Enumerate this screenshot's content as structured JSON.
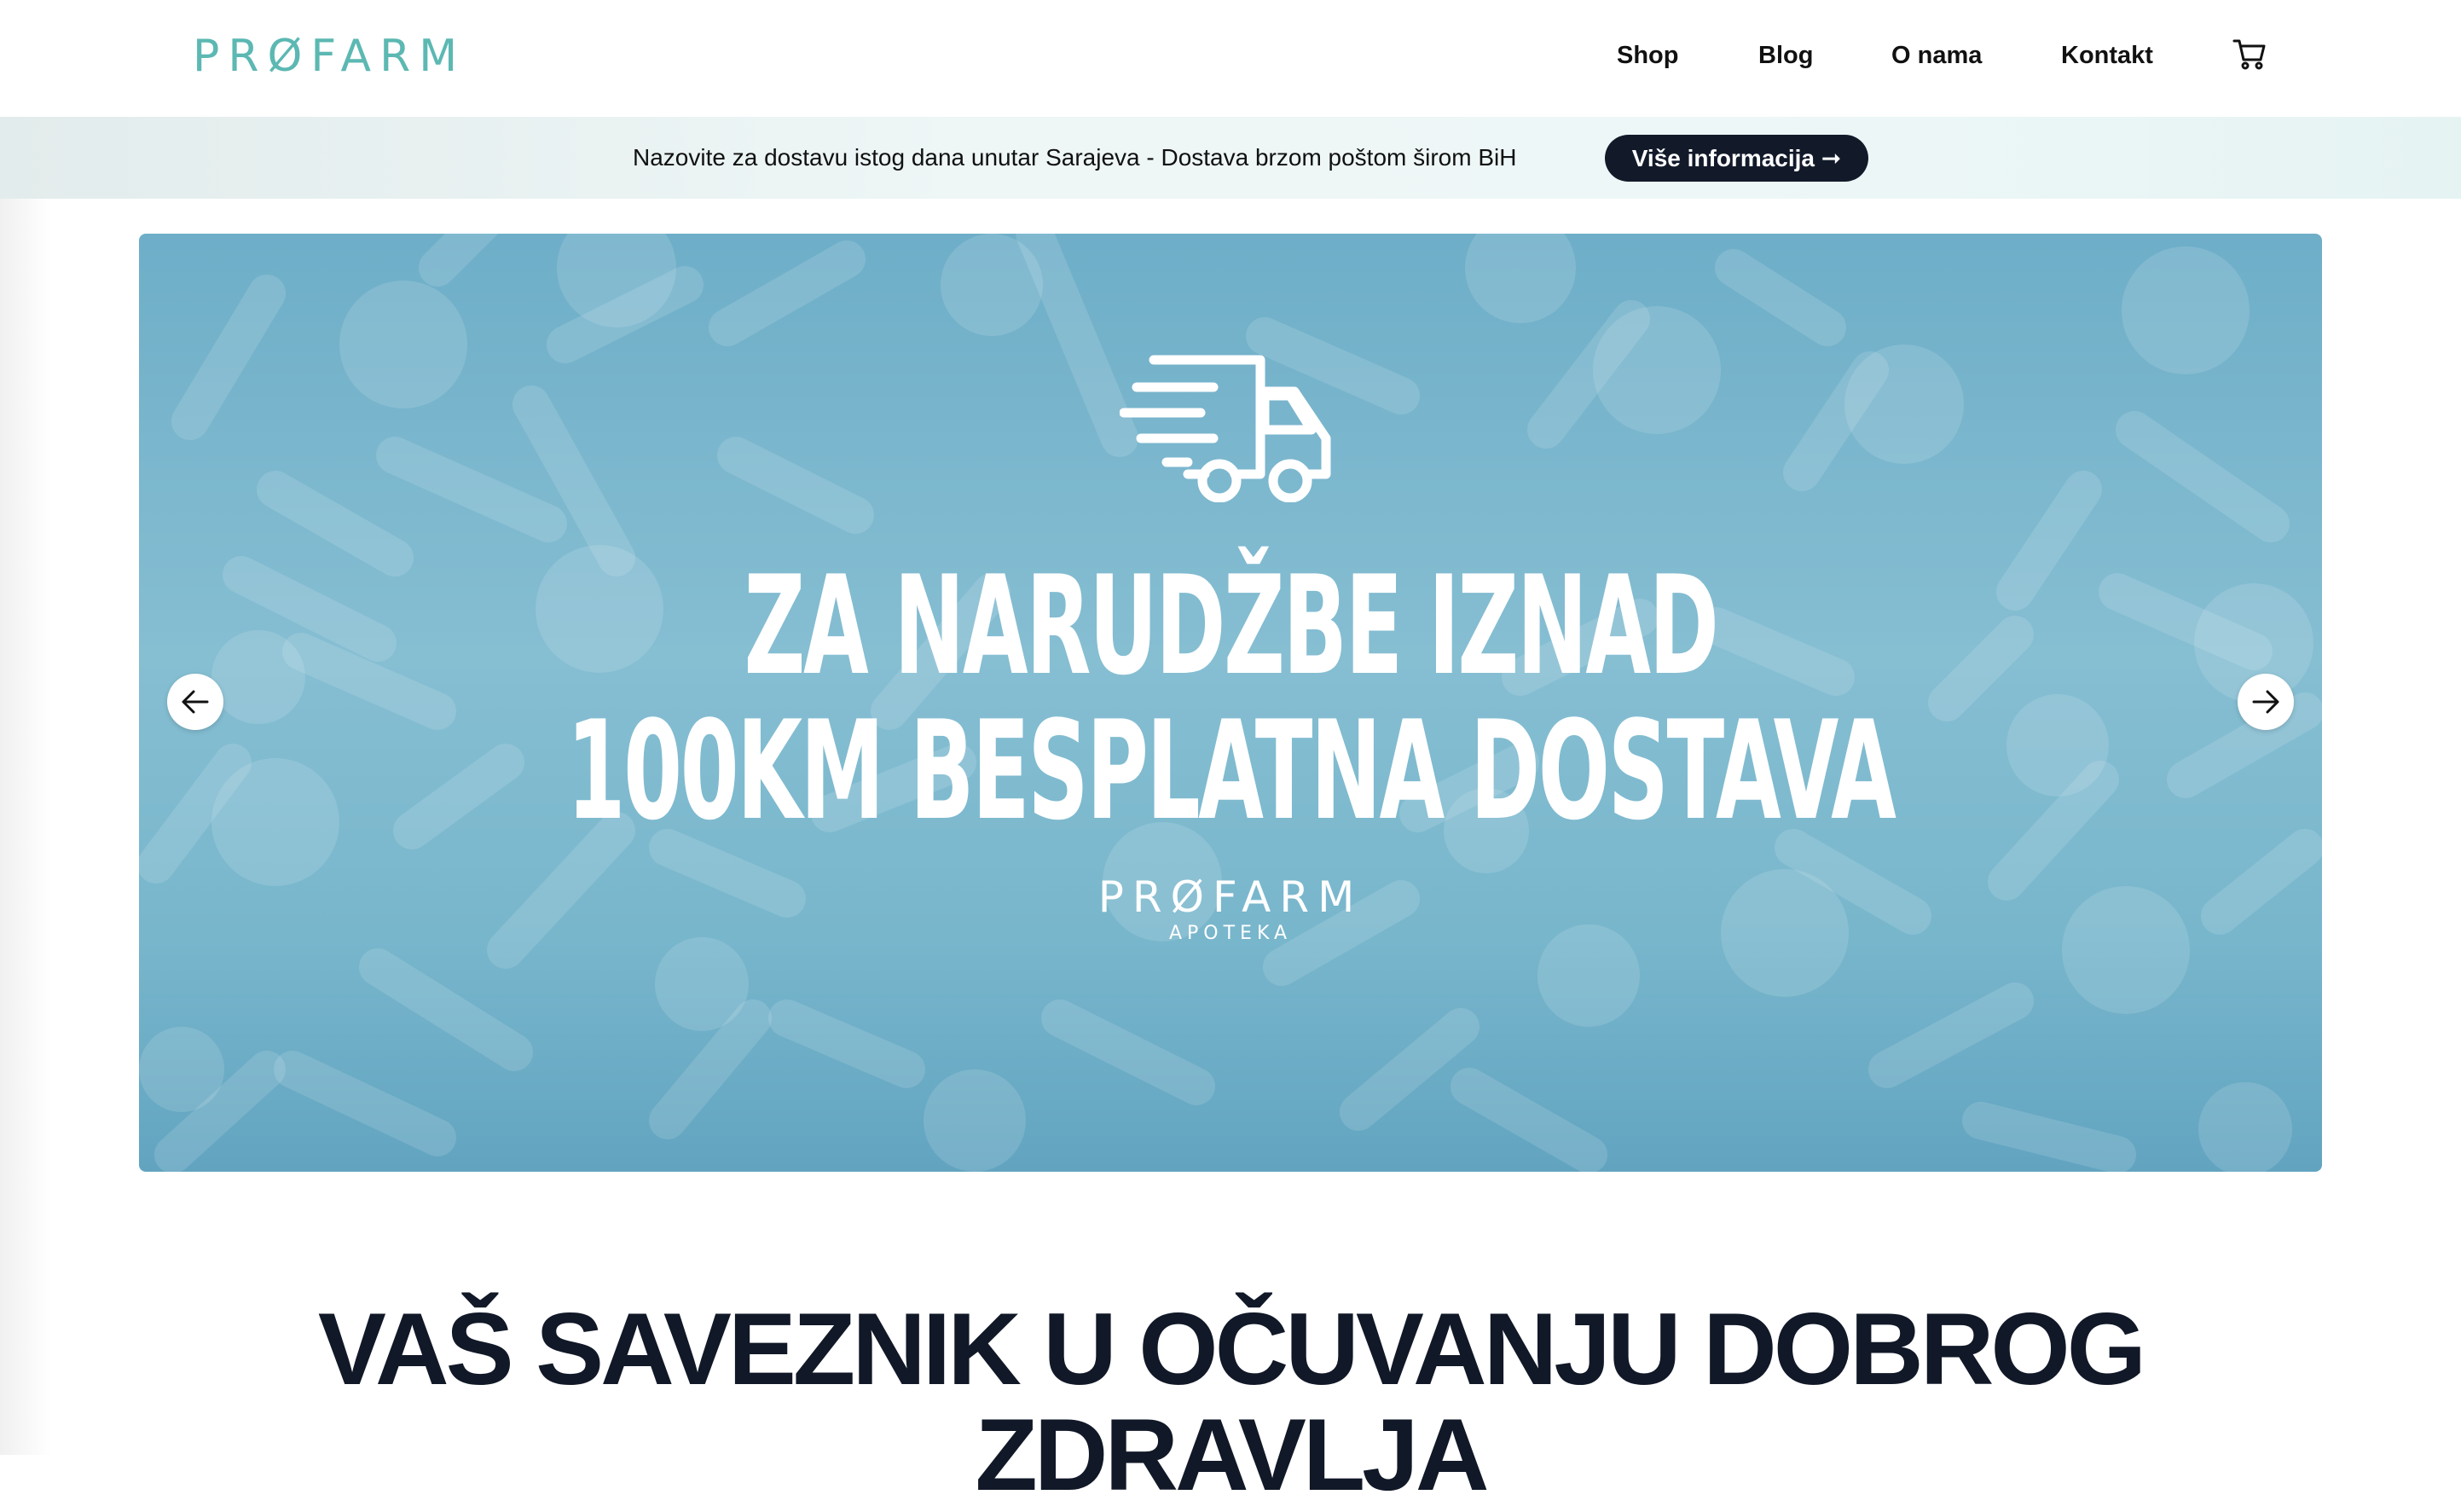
{
  "header": {
    "logo_text": "PRØFARM",
    "nav": [
      {
        "label": "Shop"
      },
      {
        "label": "Blog"
      },
      {
        "label": "O nama"
      },
      {
        "label": "Kontakt"
      }
    ],
    "cart_icon": "cart-icon"
  },
  "announcement": {
    "text": "Nazovite za dostavu istog dana unutar Sarajeva - Dostava brzom poštom širom BiH",
    "button_label": "Više informacija ➞"
  },
  "hero": {
    "icon": "delivery-truck-icon",
    "line1": "ZA NARUDŽBE IZNAD",
    "line2": "100KM BESPLATNA DOSTAVA",
    "logo_text": "PRØFARM",
    "logo_sub": "APOTEKA",
    "prev_icon": "arrow-left-icon",
    "next_icon": "arrow-right-icon"
  },
  "headline": {
    "line1": "VAŠ SAVEZNIK U OČUVANJU DOBROG",
    "line2": "ZDRAVLJA"
  },
  "colors": {
    "brand_teal": "#5cb8b2",
    "button_dark": "#121a2a",
    "hero_blue": "#7db8ce",
    "headline": "#111827"
  }
}
